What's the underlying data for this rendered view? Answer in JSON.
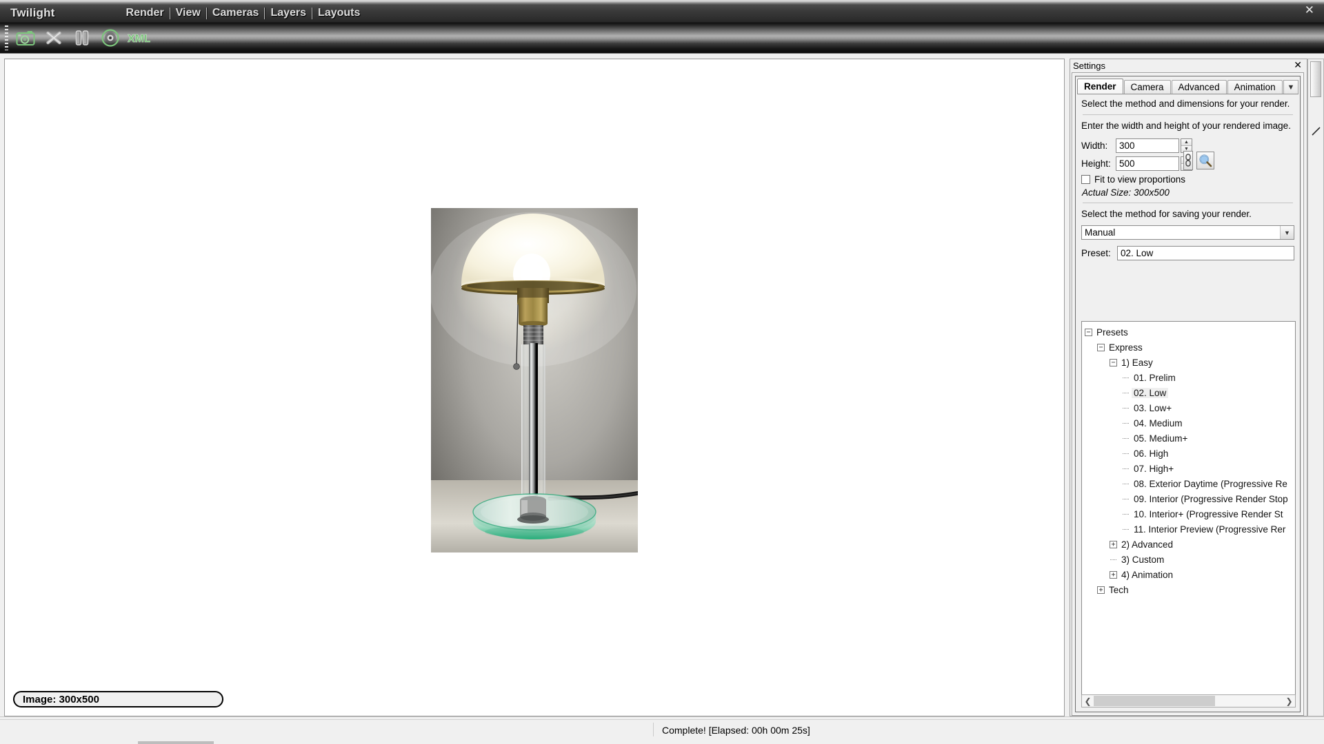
{
  "window": {
    "app_name": "Twilight",
    "close_label": "✕"
  },
  "menu": {
    "items": [
      {
        "label": "Render"
      },
      {
        "label": "View"
      },
      {
        "label": "Cameras"
      },
      {
        "label": "Layers"
      },
      {
        "label": "Layouts"
      }
    ]
  },
  "toolbar": {
    "buttons": [
      {
        "icon": "camera-render-icon",
        "title": "Render"
      },
      {
        "icon": "stop-x-icon",
        "title": "Stop"
      },
      {
        "icon": "pause-icon",
        "title": "Pause"
      },
      {
        "icon": "disc-icon",
        "title": "Save"
      },
      {
        "icon": "xml-icon",
        "title": "XML"
      }
    ]
  },
  "canvas": {
    "image_label": "Image: 300x500",
    "render_title": "Wagenfeld table lamp render"
  },
  "settings": {
    "title": "Settings",
    "close_label": "✕",
    "tabs": [
      {
        "label": "Render",
        "active": true
      },
      {
        "label": "Camera",
        "active": false
      },
      {
        "label": "Advanced",
        "active": false
      },
      {
        "label": "Animation",
        "active": false
      }
    ],
    "tab_overflow_icon": "chevron-down-icon",
    "desc_method": "Select the method and dimensions for your render.",
    "desc_dimensions": "Enter the width and height of your rendered image.",
    "width_label": "Width:",
    "width_value": "300",
    "height_label": "Height:",
    "height_value": "500",
    "link_icon": "link-chain-icon",
    "zoom_icon": "magnifier-icon",
    "fit_checkbox_label": "Fit to view proportions",
    "fit_checkbox_checked": false,
    "actual_size": "Actual Size: 300x500",
    "desc_saving": "Select the method for saving your render.",
    "save_method_value": "Manual",
    "save_method_options": [
      "Manual"
    ],
    "preset_label": "Preset:",
    "preset_value": "02. Low",
    "scroll_left_icon": "chevron-left-icon",
    "scroll_right_icon": "chevron-right-icon"
  },
  "tree": {
    "nodes": [
      {
        "label": "Presets",
        "depth": 0,
        "marker": "minus",
        "selected": false
      },
      {
        "label": "Express",
        "depth": 1,
        "marker": "minus",
        "selected": false
      },
      {
        "label": "1) Easy",
        "depth": 2,
        "marker": "minus",
        "selected": false
      },
      {
        "label": "01. Prelim",
        "depth": 3,
        "marker": "leaf",
        "selected": false
      },
      {
        "label": "02. Low",
        "depth": 3,
        "marker": "leaf",
        "selected": true
      },
      {
        "label": "03. Low+",
        "depth": 3,
        "marker": "leaf",
        "selected": false
      },
      {
        "label": "04. Medium",
        "depth": 3,
        "marker": "leaf",
        "selected": false
      },
      {
        "label": "05. Medium+",
        "depth": 3,
        "marker": "leaf",
        "selected": false
      },
      {
        "label": "06. High",
        "depth": 3,
        "marker": "leaf",
        "selected": false
      },
      {
        "label": "07. High+",
        "depth": 3,
        "marker": "leaf",
        "selected": false
      },
      {
        "label": "08. Exterior Daytime (Progressive Re",
        "depth": 3,
        "marker": "leaf",
        "selected": false
      },
      {
        "label": "09. Interior (Progressive Render Stop",
        "depth": 3,
        "marker": "leaf",
        "selected": false
      },
      {
        "label": "10. Interior+ (Progressive Render St",
        "depth": 3,
        "marker": "leaf",
        "selected": false
      },
      {
        "label": "11. Interior Preview (Progressive Rer",
        "depth": 3,
        "marker": "leaf",
        "selected": false
      },
      {
        "label": "2) Advanced",
        "depth": 2,
        "marker": "plus",
        "selected": false
      },
      {
        "label": "3) Custom",
        "depth": 2,
        "marker": "leaf",
        "selected": false
      },
      {
        "label": "4) Animation",
        "depth": 2,
        "marker": "plus",
        "selected": false
      },
      {
        "label": "Tech",
        "depth": 1,
        "marker": "plus",
        "selected": false
      }
    ]
  },
  "status": {
    "text": "Complete!  [Elapsed: 00h 00m 25s]"
  },
  "colors": {
    "accent_green": "#5aa85a",
    "titlebar_dark": "#2f2f2f",
    "panel_bg": "#f0f0f0",
    "selection": "#efefef"
  }
}
